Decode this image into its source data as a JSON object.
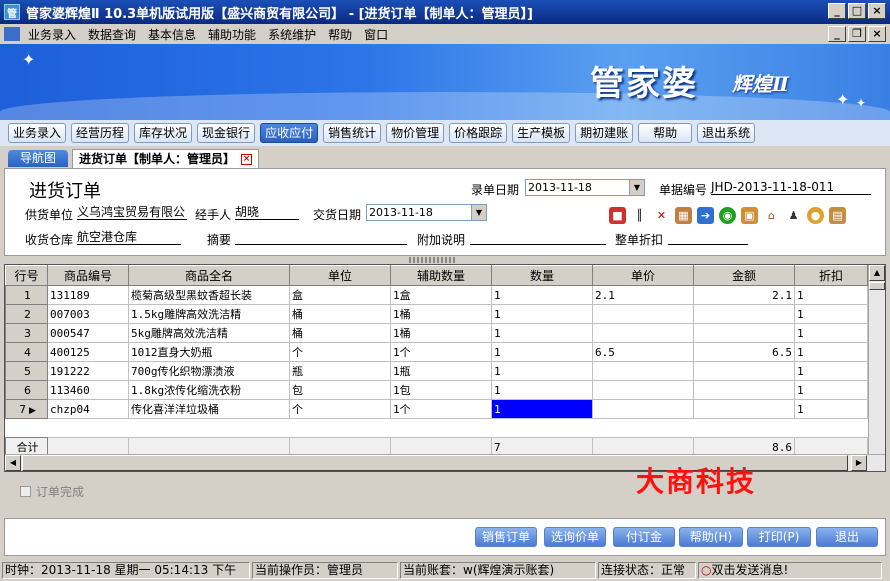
{
  "window": {
    "title": "管家婆辉煌Ⅱ 10.3单机版试用版【盛兴商贸有限公司】 - [进货订单【制单人：管理员】]"
  },
  "menu": [
    "业务录入",
    "数据查询",
    "基本信息",
    "辅助功能",
    "系统维护",
    "帮助",
    "窗口"
  ],
  "banner": {
    "logo": "管家婆",
    "logo_sub": "辉煌Ⅱ"
  },
  "toolbar": [
    "业务录入",
    "经营历程",
    "库存状况",
    "现金银行",
    "应收应付",
    "销售统计",
    "物价管理",
    "价格跟踪",
    "生产模板",
    "期初建账",
    "帮助",
    "退出系统"
  ],
  "toolbar_active": "应收应付",
  "tabs": {
    "nav": "导航图",
    "current": "进货订单【制单人：管理员】"
  },
  "form": {
    "title": "进货订单",
    "entry_date_label": "录单日期",
    "entry_date": "2013-11-18",
    "doc_no_label": "单据编号",
    "doc_no": "JHD-2013-11-18-011",
    "supplier_label": "供货单位",
    "supplier": "义乌鸿宝贸易有限公",
    "handler_label": "经手人",
    "handler": "胡晓",
    "delivery_date_label": "交货日期",
    "delivery_date": "2013-11-18",
    "warehouse_label": "收货仓库",
    "warehouse": "航空港仓库",
    "summary_label": "摘要",
    "summary": "",
    "note_label": "附加说明",
    "note": "",
    "discount_label": "整单折扣",
    "discount": ""
  },
  "toolbar_icons": [
    "colors-icon",
    "barcode-icon",
    "tools-icon",
    "calculator-icon",
    "export-icon",
    "target-icon",
    "box-icon",
    "home-icon",
    "user-icon",
    "palette-icon",
    "clipboard-icon"
  ],
  "table": {
    "headers": [
      "行号",
      "商品编号",
      "商品全名",
      "单位",
      "辅助数量",
      "数量",
      "单价",
      "金额",
      "折扣"
    ],
    "rows": [
      {
        "no": "1",
        "code": "131189",
        "name": "榄菊高级型黑蚊香超长装",
        "unit": "盒",
        "aux": "1盒",
        "qty": "1",
        "price": "2.1",
        "amount": "2.1",
        "disc": "1"
      },
      {
        "no": "2",
        "code": "007003",
        "name": "1.5kg雕牌高效洗洁精",
        "unit": "桶",
        "aux": "1桶",
        "qty": "1",
        "price": "",
        "amount": "",
        "disc": "1"
      },
      {
        "no": "3",
        "code": "000547",
        "name": "5kg雕牌高效洗洁精",
        "unit": "桶",
        "aux": "1桶",
        "qty": "1",
        "price": "",
        "amount": "",
        "disc": "1"
      },
      {
        "no": "4",
        "code": "400125",
        "name": "1012直身大奶瓶",
        "unit": "个",
        "aux": "1个",
        "qty": "1",
        "price": "6.5",
        "amount": "6.5",
        "disc": "1"
      },
      {
        "no": "5",
        "code": "191222",
        "name": "700g传化织物漂渍液",
        "unit": "瓶",
        "aux": "1瓶",
        "qty": "1",
        "price": "",
        "amount": "",
        "disc": "1"
      },
      {
        "no": "6",
        "code": "113460",
        "name": "1.8kg浓传化缩洗衣粉",
        "unit": "包",
        "aux": "1包",
        "qty": "1",
        "price": "",
        "amount": "",
        "disc": "1"
      },
      {
        "no": "7",
        "code": "chzp04",
        "name": "传化喜洋洋垃圾桶",
        "unit": "个",
        "aux": "1个",
        "qty": "1",
        "price": "",
        "amount": "",
        "disc": "1"
      }
    ],
    "total_label": "合计",
    "total_qty": "7",
    "total_amount": "8.6"
  },
  "watermark": "大商科技",
  "order_done_label": "订单完成",
  "buttons": [
    "销售订单",
    "选询价单",
    "付订金",
    "帮助(H)",
    "打印(P)",
    "退出"
  ],
  "status": {
    "clock": "时钟：2013-11-18 星期一 05:14:13 下午",
    "operator": "当前操作员：管理员",
    "account": "当前账套：w(辉煌演示账套)",
    "connection": "连接状态：正常",
    "message": "双击发送消息!"
  }
}
